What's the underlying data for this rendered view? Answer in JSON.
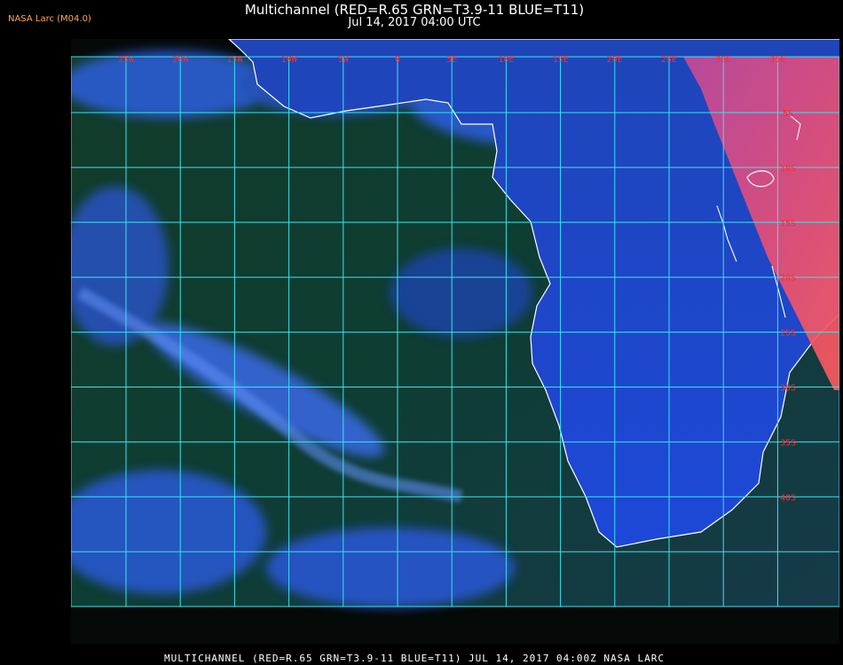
{
  "badge": "NASA Larc (M04.0)",
  "header": {
    "title": "Multichannel (RED=R.65 GRN=T3.9-11 BLUE=T11)",
    "timestamp": "Jul 14, 2017 04:00 UTC"
  },
  "footer_caption": "MULTICHANNEL (RED=R.65 GRN=T3.9-11 BLUE=T11) JUL 14, 2017 04:00Z   NASA LARC",
  "map": {
    "longitude_labels": [
      "25W",
      "20W",
      "15W",
      "10W",
      "5W",
      "0",
      "5E",
      "10E",
      "15E",
      "20E",
      "25E",
      "30E",
      "35E"
    ],
    "latitude_labels": [
      "5S",
      "10S",
      "15S",
      "20S",
      "25S",
      "30S",
      "35S",
      "40S"
    ],
    "colors": {
      "grid": "#33e6ee",
      "coastline": "#ffffff",
      "grid_label": "#ff2a2a",
      "ocean": "#0f3a2c",
      "cloud": "#2f5fe0",
      "hot_cloud": "#ff4f78"
    }
  }
}
